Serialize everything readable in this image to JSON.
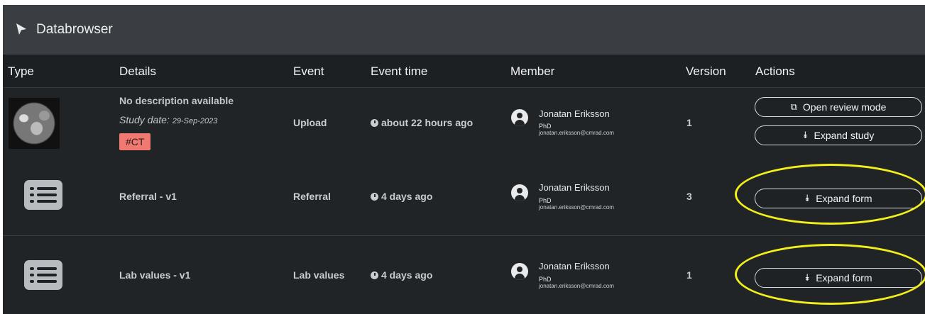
{
  "titlebar": {
    "title": "Databrowser"
  },
  "columns": {
    "type": "Type",
    "details": "Details",
    "event": "Event",
    "event_time": "Event time",
    "member": "Member",
    "version": "Version",
    "actions": "Actions"
  },
  "rows": [
    {
      "details": "No description available",
      "study_date_label": "Study date:",
      "study_date_value": "29-Sep-2023",
      "tag": "#CT",
      "event": "Upload",
      "event_time": "about 22 hours ago",
      "member_name": "Jonatan Eriksson",
      "member_title": "PhD",
      "member_email": "jonatan.eriksson@cmrad.com",
      "version": "1",
      "actions": [
        "Open review mode",
        "Expand study"
      ]
    },
    {
      "details": "Referral - v1",
      "event": "Referral",
      "event_time": "4 days ago",
      "member_name": "Jonatan Eriksson",
      "member_title": "PhD",
      "member_email": "jonatan.eriksson@cmrad.com",
      "version": "3",
      "actions": [
        "Expand form"
      ]
    },
    {
      "details": "Lab values - v1",
      "event": "Lab values",
      "event_time": "4 days ago",
      "member_name": "Jonatan Eriksson",
      "member_title": "PhD",
      "member_email": "jonatan.eriksson@cmrad.com",
      "version": "1",
      "actions": [
        "Expand form"
      ]
    }
  ],
  "icons": {
    "title": "cursor-icon",
    "open_review": "external-link-icon",
    "expand": "double-chevron-down-icon",
    "form_type": "list-icon",
    "time": "clock-icon",
    "member": "user-avatar-icon"
  },
  "colors": {
    "tag_bg": "#f07a71",
    "highlight": "#f2ef1a",
    "background": "#1f2225"
  }
}
